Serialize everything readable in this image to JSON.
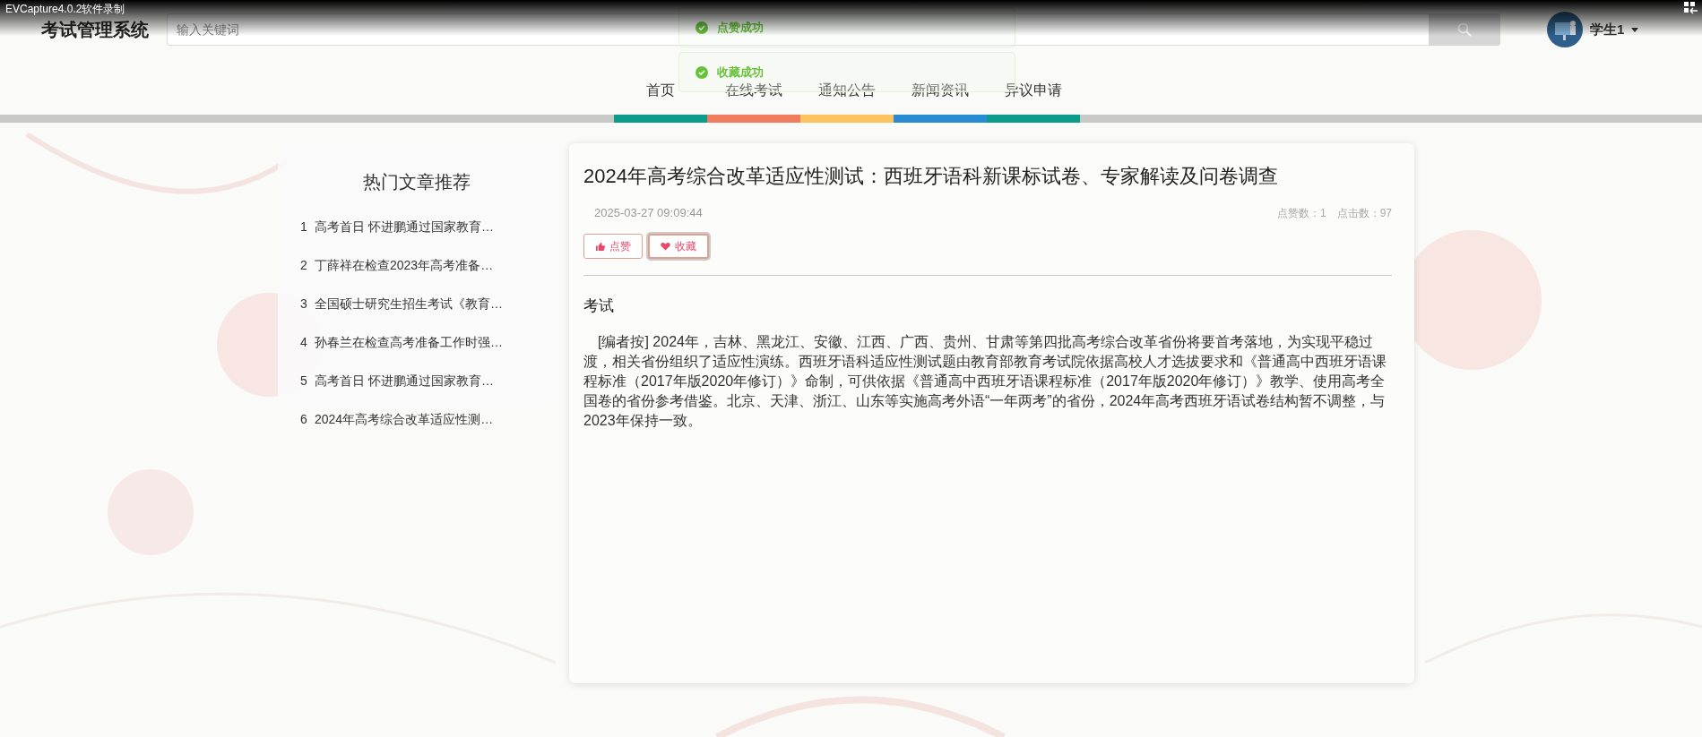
{
  "recorder_overlay": {
    "title": "EVCapture4.0.2软件录制"
  },
  "header": {
    "logo": "考试管理系统",
    "search": {
      "placeholder": "输入关键词"
    },
    "user": {
      "name": "学生1"
    }
  },
  "nav": [
    {
      "label": "首页",
      "color": "#0c9c8c"
    },
    {
      "label": "在线考试",
      "color": "#f07b5d"
    },
    {
      "label": "通知公告",
      "color": "#fcc35e"
    },
    {
      "label": "新闻资讯",
      "color": "#2a8bd5"
    },
    {
      "label": "异议申请",
      "color": "#0c9c8c"
    }
  ],
  "toasts": [
    {
      "message": "点赞成功"
    },
    {
      "message": "收藏成功"
    }
  ],
  "sidebar": {
    "title": "热门文章推荐",
    "items": [
      {
        "index": "1",
        "title": "高考首日 怀进鹏通过国家教育…"
      },
      {
        "index": "2",
        "title": "丁薛祥在检查2023年高考准备…"
      },
      {
        "index": "3",
        "title": "全国硕士研究生招生考试《教育…"
      },
      {
        "index": "4",
        "title": "孙春兰在检查高考准备工作时强…"
      },
      {
        "index": "5",
        "title": "高考首日 怀进鹏通过国家教育…"
      },
      {
        "index": "6",
        "title": "2024年高考综合改革适应性测…"
      }
    ]
  },
  "article": {
    "title": "2024年高考综合改革适应性测试：西班牙语科新课标试卷、专家解读及问卷调查",
    "date": "2025-03-27 09:09:44",
    "likes": "点赞数：1",
    "clicks": "点击数：97",
    "buttons": [
      {
        "label": "点赞",
        "kind": "like",
        "selected": false
      },
      {
        "label": "收藏",
        "kind": "favorite",
        "selected": true
      }
    ],
    "category": "考试",
    "body": "[编者按] 2024年，吉林、黑龙江、安徽、江西、广西、贵州、甘肃等第四批高考综合改革省份将要首考落地，为实现平稳过渡，相关省份组织了适应性演练。西班牙语科适应性测试题由教育部教育考试院依据高校人才选拔要求和《普通高中西班牙语课程标准（2017年版2020年修订）》命制，可供依据《普通高中西班牙语课程标准（2017年版2020年修订）》教学、使用高考全国卷的省份参考借鉴。北京、天津、浙江、山东等实施高考外语“一年两考”的省份，2024年高考西班牙语试卷结构暂不调整，与2023年保持一致。"
  }
}
